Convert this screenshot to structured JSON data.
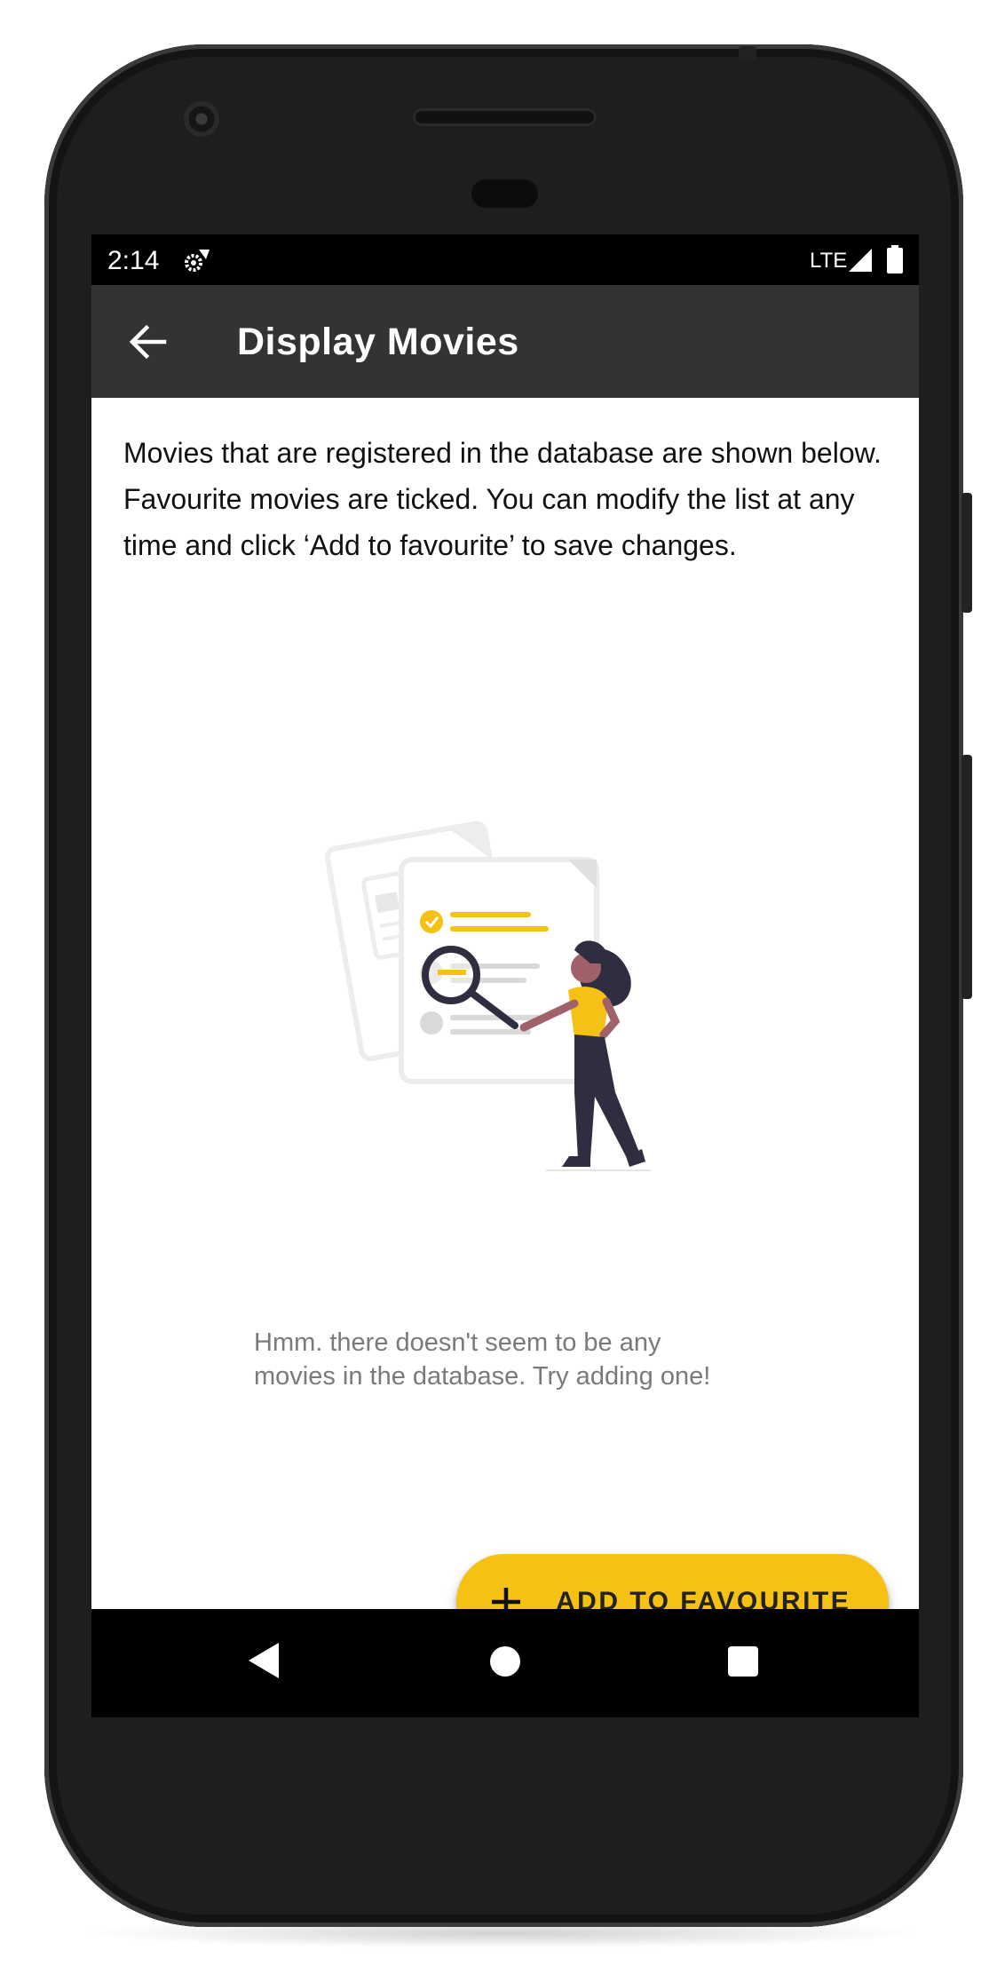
{
  "status_bar": {
    "time": "2:14",
    "network": "LTE",
    "icons": [
      "settings-gear-icon",
      "signal-icon",
      "battery-icon"
    ]
  },
  "app_bar": {
    "title": "Display Movies",
    "back_icon": "arrow-left-icon"
  },
  "content": {
    "intro": "Movies that are registered in the database are shown below. Favourite movies are ticked. You can modify the list at any time and click ‘Add to favourite’ to save changes.",
    "empty_message_line1": "Hmm. there doesn't seem to be any",
    "empty_message_line2": "movies in the database. Try adding one!"
  },
  "fab": {
    "label": "ADD TO FAVOURITE",
    "icon": "plus-icon"
  },
  "nav_bar": {
    "icons": [
      "nav-back-icon",
      "nav-home-icon",
      "nav-recents-icon"
    ]
  },
  "colors": {
    "accent": "#f5c114",
    "app_bar": "#333333",
    "illustration_figure": "#2f2e41"
  }
}
